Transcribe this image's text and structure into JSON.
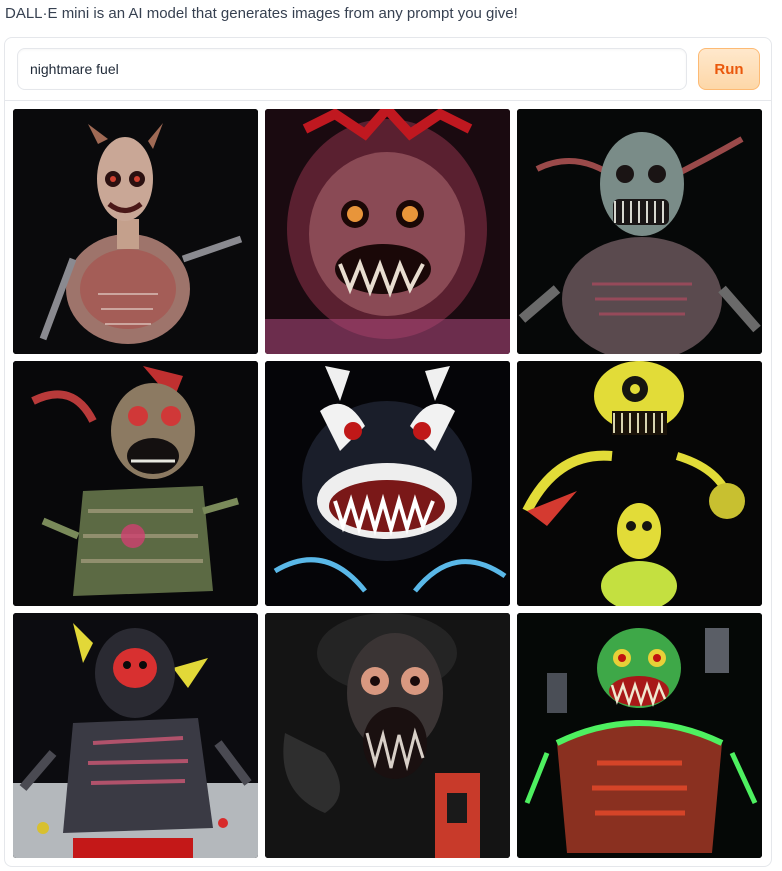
{
  "description": "DALL·E mini is an AI model that generates images from any prompt you give!",
  "prompt": {
    "value": "nightmare fuel"
  },
  "run_button": {
    "label": "Run"
  },
  "gallery": {
    "images": [
      {
        "icon": "pale-ghoul-image",
        "accent": "#c96a5a"
      },
      {
        "icon": "red-furry-monster-image",
        "accent": "#b33a44"
      },
      {
        "icon": "green-goblin-image",
        "accent": "#8a9a9a"
      },
      {
        "icon": "green-zombie-clown-image",
        "accent": "#b2a84a"
      },
      {
        "icon": "white-red-demon-face-image",
        "accent": "#e6e6e6"
      },
      {
        "icon": "yellow-skull-creatures-image",
        "accent": "#e6e23a"
      },
      {
        "icon": "dark-hairy-monster-image",
        "accent": "#c94a55"
      },
      {
        "icon": "gray-smoke-creature-image",
        "accent": "#8a8a8a"
      },
      {
        "icon": "neon-green-demon-image",
        "accent": "#3fe05a"
      }
    ]
  }
}
